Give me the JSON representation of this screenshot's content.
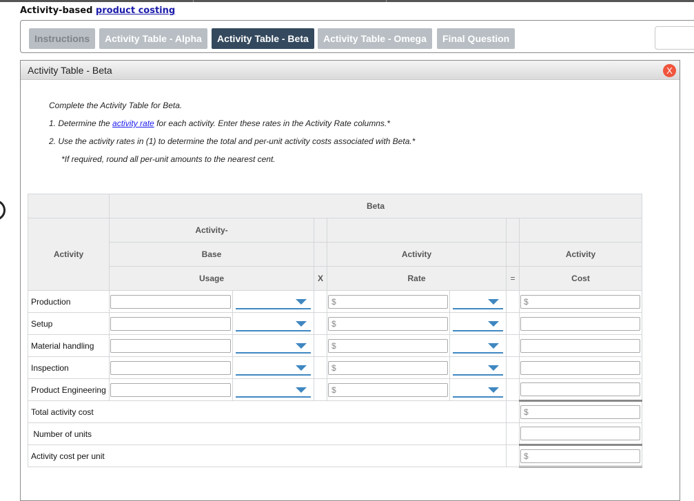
{
  "page": {
    "title_prefix": "Activity-based",
    "title_link": "product costing"
  },
  "tabs": [
    {
      "label": "Instructions",
      "state": "disabled"
    },
    {
      "label": "Activity Table - Alpha",
      "state": "normal"
    },
    {
      "label": "Activity Table - Beta",
      "state": "active"
    },
    {
      "label": "Activity Table - Omega",
      "state": "normal"
    },
    {
      "label": "Final Question",
      "state": "normal"
    }
  ],
  "panel": {
    "title": "Activity Table - Beta",
    "close_label": "X"
  },
  "instructions": {
    "intro": "Complete the Activity Table for Beta.",
    "step1_prefix": "1.  Determine the ",
    "step1_link": "activity rate",
    "step1_suffix": " for each activity. Enter these rates in the Activity Rate columns.*",
    "step2": "2.  Use the activity rates in (1) to determine the total and per-unit activity costs associated with Beta.*",
    "note": "*If required, round all per-unit amounts to the nearest cent."
  },
  "table": {
    "group_header": "Beta",
    "col_activity": "Activity",
    "col_base_line1": "Activity-",
    "col_base_line2": "Base",
    "col_base_line3": "Usage",
    "op_multiply": "X",
    "col_rate_line1": "Activity",
    "col_rate_line2": "Rate",
    "op_equals": "=",
    "col_cost_line1": "Activity",
    "col_cost_line2": "Cost",
    "currency": "$",
    "rows": [
      {
        "label": "Production",
        "usage": "",
        "usage_unit": "",
        "rate": "",
        "rate_unit": "",
        "cost": "",
        "cost_prefix": "$"
      },
      {
        "label": "Setup",
        "usage": "",
        "usage_unit": "",
        "rate": "",
        "rate_unit": "",
        "cost": "",
        "cost_prefix": ""
      },
      {
        "label": "Material handling",
        "usage": "",
        "usage_unit": "",
        "rate": "",
        "rate_unit": "",
        "cost": "",
        "cost_prefix": ""
      },
      {
        "label": "Inspection",
        "usage": "",
        "usage_unit": "",
        "rate": "",
        "rate_unit": "",
        "cost": "",
        "cost_prefix": ""
      },
      {
        "label": "Product Engineering",
        "usage": "",
        "usage_unit": "",
        "rate": "",
        "rate_unit": "",
        "cost": "",
        "cost_prefix": ""
      }
    ],
    "summary": [
      {
        "label": "Total activity cost",
        "value": "",
        "prefix": "$"
      },
      {
        "label": " Number of units",
        "value": "",
        "prefix": ""
      },
      {
        "label": "Activity cost per unit",
        "value": "",
        "prefix": "$"
      }
    ]
  }
}
